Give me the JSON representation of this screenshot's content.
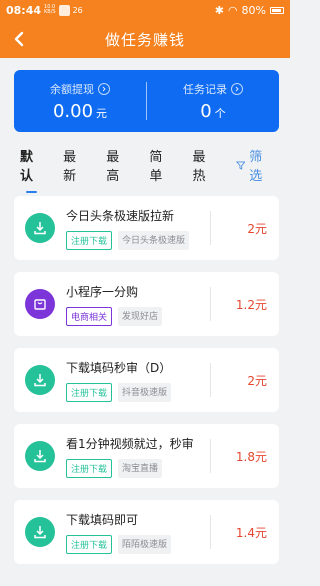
{
  "status_bar": {
    "time": "08:44",
    "net_speed": "10.0",
    "net_unit": "KB/S",
    "extra_icon": "26",
    "battery_percent": "80%"
  },
  "header": {
    "title": "做任务赚钱",
    "background_color": "#f5821f"
  },
  "summary": {
    "balance_label": "余额提现",
    "balance_value": "0.00",
    "balance_unit": "元",
    "records_label": "任务记录",
    "records_value": "0",
    "records_unit": "个",
    "card_color": "#0f6cf2"
  },
  "tabs": [
    {
      "label": "默认",
      "active": true
    },
    {
      "label": "最新"
    },
    {
      "label": "最高"
    },
    {
      "label": "简单"
    },
    {
      "label": "最热"
    }
  ],
  "filter_label": "筛选",
  "tasks": [
    {
      "title": "今日头条极速版拉新",
      "type_tag": "注册下载",
      "app_tag": "今日头条极速版",
      "reward": "2元",
      "icon": "download-icon"
    },
    {
      "title": "小程序一分购",
      "type_tag": "电商相关",
      "app_tag": "发现好店",
      "reward": "1.2元",
      "icon": "shopping-bag-icon"
    },
    {
      "title": "下载填码秒审（D）",
      "type_tag": "注册下载",
      "app_tag": "抖音极速版",
      "reward": "2元",
      "icon": "download-icon"
    },
    {
      "title": "看1分钟视频就过，秒审",
      "type_tag": "注册下载",
      "app_tag": "淘宝直播",
      "reward": "1.8元",
      "icon": "download-icon"
    },
    {
      "title": "下载填码即可",
      "type_tag": "注册下载",
      "app_tag": "陌陌极速版",
      "reward": "1.4元",
      "icon": "download-icon"
    }
  ]
}
